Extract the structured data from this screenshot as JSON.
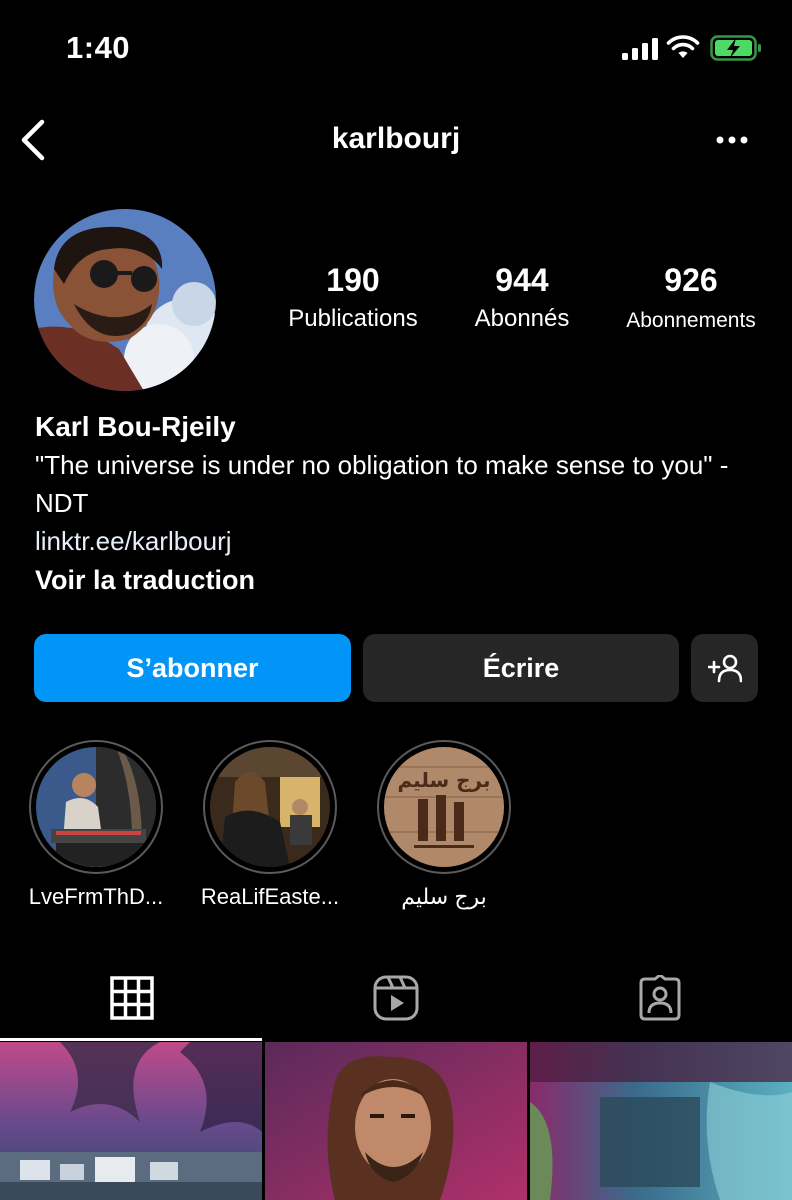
{
  "status_bar": {
    "time": "1:40"
  },
  "header": {
    "username": "karlbourj"
  },
  "stats": {
    "posts_count": "190",
    "posts_label": "Publications",
    "followers_count": "944",
    "followers_label": "Abonnés",
    "following_count": "926",
    "following_label": "Abonnements"
  },
  "bio": {
    "name": "Karl Bou-Rjeily",
    "text": "\"The universe is under no obligation to make sense to you\" - NDT",
    "link": "linktr.ee/karlbourj",
    "translate": "Voir la traduction"
  },
  "actions": {
    "follow": "S’abonner",
    "message": "Écrire"
  },
  "highlights": [
    {
      "label": "LveFrmThD..."
    },
    {
      "label": "ReaLifEaste..."
    },
    {
      "label": "برج سليم",
      "cover_text": "برج سليم"
    }
  ],
  "tabs": [
    {
      "icon": "grid-icon",
      "active": true
    },
    {
      "icon": "reels-icon",
      "active": false
    },
    {
      "icon": "tagged-icon",
      "active": false
    }
  ],
  "colors": {
    "background": "#000000",
    "primary_button": "#0095f6",
    "secondary_button": "#262626",
    "battery": "#4cd964"
  }
}
